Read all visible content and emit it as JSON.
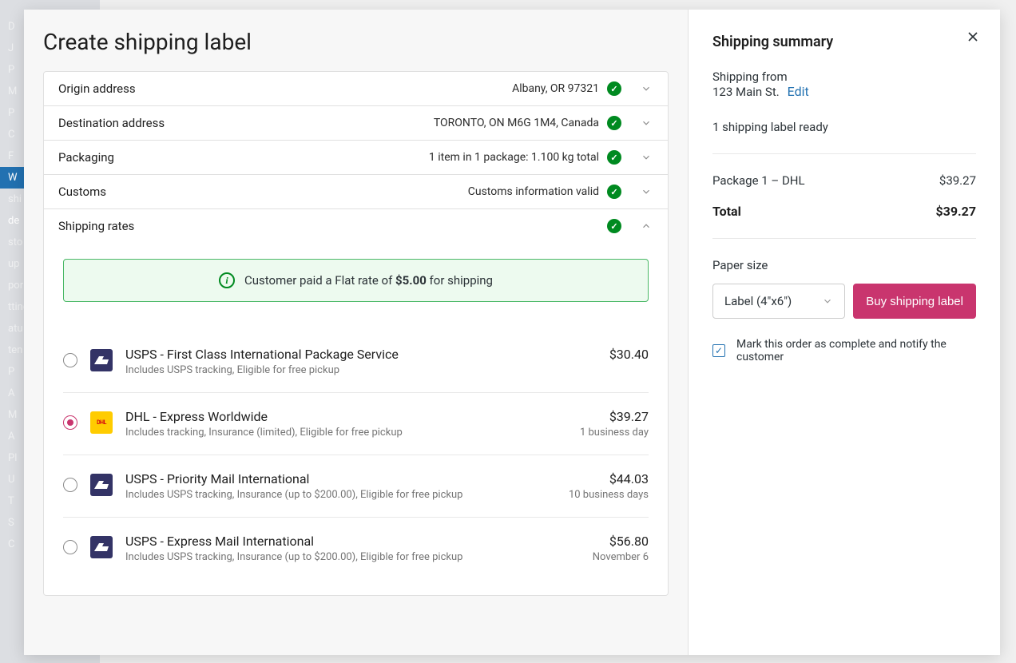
{
  "title": "Create shipping label",
  "sections": {
    "origin": {
      "label": "Origin address",
      "value": "Albany, OR  97321"
    },
    "destination": {
      "label": "Destination address",
      "value": "TORONTO, ON  M6G 1M4, Canada"
    },
    "packaging": {
      "label": "Packaging",
      "value": "1 item in 1 package: 1.100 kg total"
    },
    "customs": {
      "label": "Customs",
      "value": "Customs information valid"
    },
    "rates": {
      "label": "Shipping rates"
    }
  },
  "banner": {
    "prefix": "Customer paid a Flat rate of ",
    "amount": "$5.00",
    "suffix": " for shipping"
  },
  "rates": [
    {
      "carrier": "usps",
      "name": "USPS - First Class International Package Service",
      "desc": "Includes USPS tracking, Eligible for free pickup",
      "price": "$30.40",
      "eta": "",
      "selected": false
    },
    {
      "carrier": "dhl",
      "name": "DHL - Express Worldwide",
      "desc": "Includes tracking, Insurance (limited), Eligible for free pickup",
      "price": "$39.27",
      "eta": "1 business day",
      "selected": true
    },
    {
      "carrier": "usps",
      "name": "USPS - Priority Mail International",
      "desc": "Includes USPS tracking, Insurance (up to $200.00), Eligible for free pickup",
      "price": "$44.03",
      "eta": "10 business days",
      "selected": false
    },
    {
      "carrier": "usps",
      "name": "USPS - Express Mail International",
      "desc": "Includes USPS tracking, Insurance (up to $200.00), Eligible for free pickup",
      "price": "$56.80",
      "eta": "November 6",
      "selected": false
    }
  ],
  "summary": {
    "title": "Shipping summary",
    "from_label": "Shipping from",
    "from_addr": "123 Main St.",
    "edit": "Edit",
    "ready": "1 shipping label ready",
    "package_label": "Package 1 – DHL",
    "package_price": "$39.27",
    "total_label": "Total",
    "total_price": "$39.27",
    "paper_label": "Paper size",
    "paper_value": "Label (4\"x6\")",
    "buy_label": "Buy shipping label",
    "mark_complete": "Mark this order as complete and notify the customer"
  }
}
